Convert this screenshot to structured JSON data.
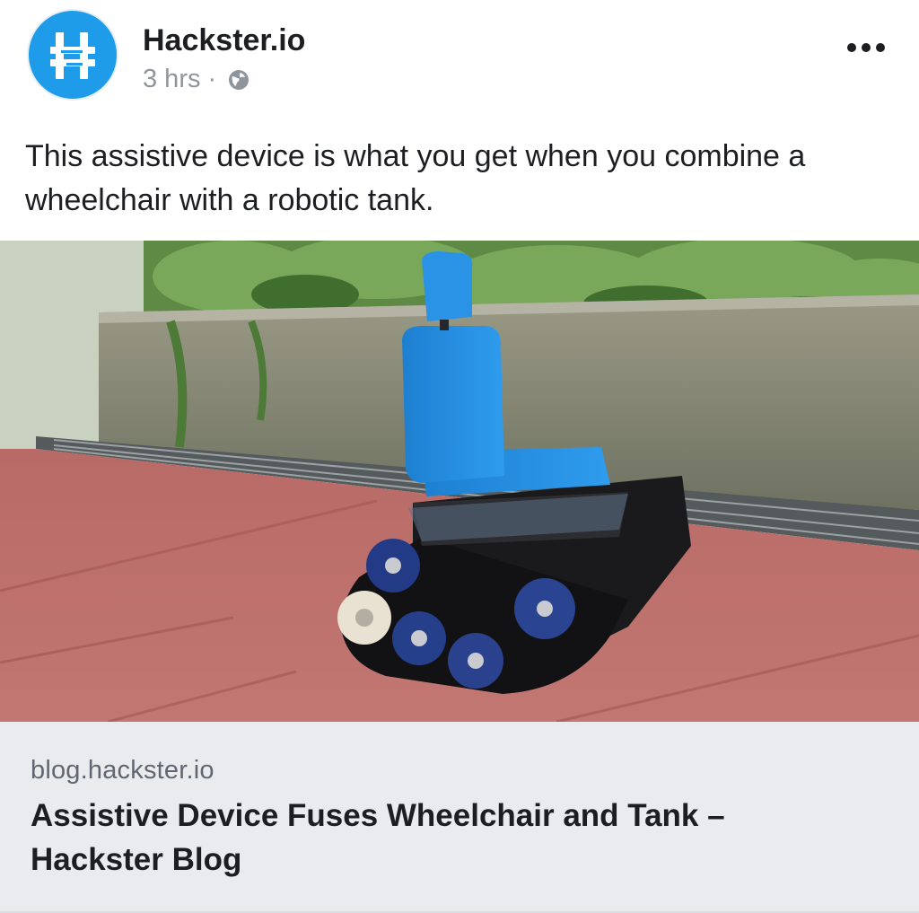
{
  "post": {
    "author": "Hackster.io",
    "time": "3 hrs",
    "separator": "·",
    "privacy_icon": "globe-icon",
    "more_icon": "more-options-icon",
    "text": "This assistive device is what you get when you combine a wheelchair with a robotic tank.",
    "avatar_icon": "hackster-logo",
    "brand_color": "#1e9be9"
  },
  "link_preview": {
    "domain": "blog.hackster.io",
    "title": "Assistive Device Fuses Wheelchair and Tank – Hackster Blog"
  }
}
